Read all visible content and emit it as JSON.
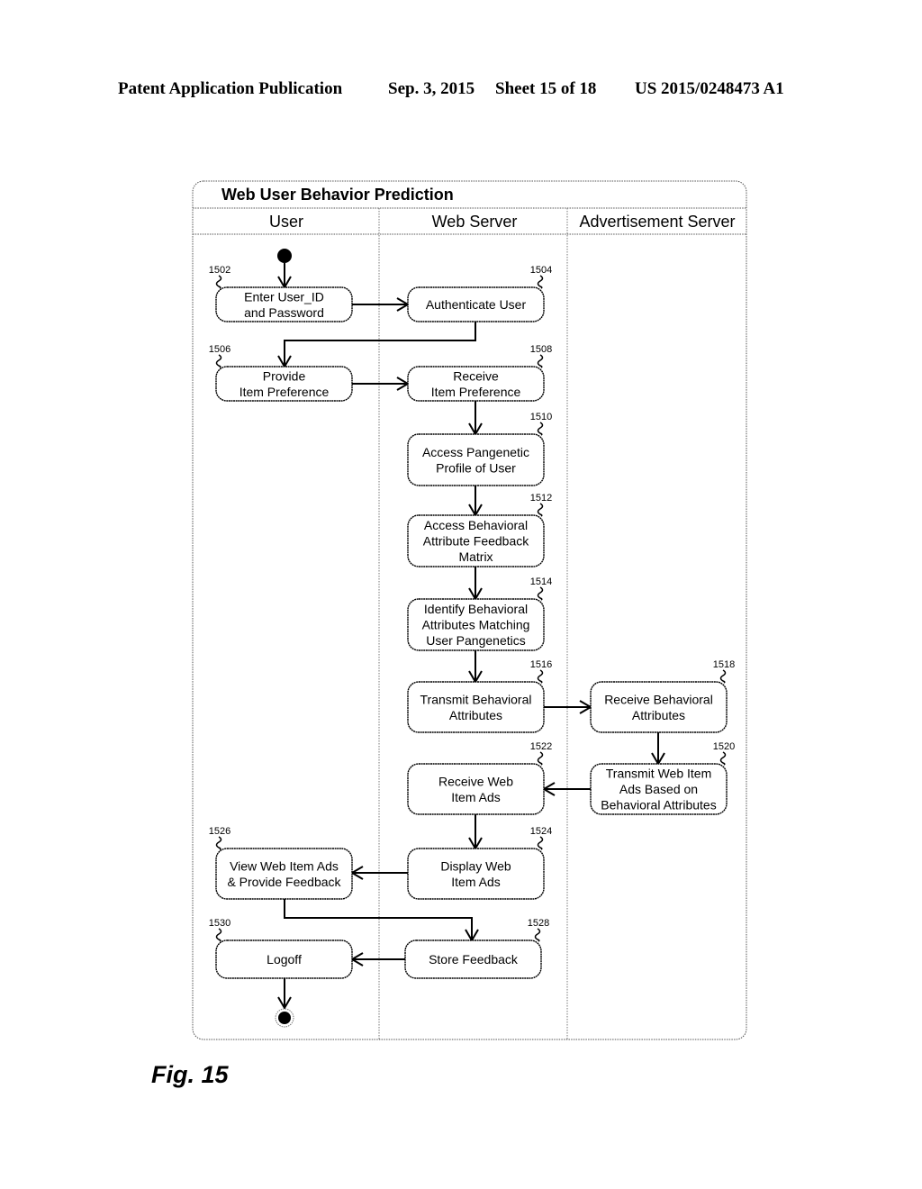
{
  "header": {
    "publication": "Patent Application Publication",
    "date": "Sep. 3, 2015",
    "sheet": "Sheet 15 of 18",
    "number": "US 2015/0248473 A1"
  },
  "diagram": {
    "title": "Web User Behavior Prediction",
    "lanes": [
      "User",
      "Web Server",
      "Advertisement Server"
    ],
    "nodes": [
      {
        "id": "1502",
        "ref": "1502",
        "lane": 0,
        "lines": [
          "Enter User_ID",
          "and Password"
        ]
      },
      {
        "id": "1504",
        "ref": "1504",
        "lane": 1,
        "lines": [
          "Authenticate User"
        ]
      },
      {
        "id": "1506",
        "ref": "1506",
        "lane": 0,
        "lines": [
          "Provide",
          "Item Preference"
        ]
      },
      {
        "id": "1508",
        "ref": "1508",
        "lane": 1,
        "lines": [
          "Receive",
          "Item Preference"
        ]
      },
      {
        "id": "1510",
        "ref": "1510",
        "lane": 1,
        "lines": [
          "Access Pangenetic",
          "Profile of User"
        ]
      },
      {
        "id": "1512",
        "ref": "1512",
        "lane": 1,
        "lines": [
          "Access Behavioral",
          "Attribute Feedback",
          "Matrix"
        ]
      },
      {
        "id": "1514",
        "ref": "1514",
        "lane": 1,
        "lines": [
          "Identify Behavioral",
          "Attributes Matching",
          "User Pangenetics"
        ]
      },
      {
        "id": "1516",
        "ref": "1516",
        "lane": 1,
        "lines": [
          "Transmit Behavioral",
          "Attributes"
        ]
      },
      {
        "id": "1518",
        "ref": "1518",
        "lane": 2,
        "lines": [
          "Receive Behavioral",
          "Attributes"
        ]
      },
      {
        "id": "1520",
        "ref": "1520",
        "lane": 2,
        "lines": [
          "Transmit Web Item",
          "Ads Based on",
          "Behavioral Attributes"
        ]
      },
      {
        "id": "1522",
        "ref": "1522",
        "lane": 1,
        "lines": [
          "Receive Web",
          "Item Ads"
        ]
      },
      {
        "id": "1524",
        "ref": "1524",
        "lane": 1,
        "lines": [
          "Display Web",
          "Item Ads"
        ]
      },
      {
        "id": "1526",
        "ref": "1526",
        "lane": 0,
        "lines": [
          "View Web Item Ads",
          "& Provide Feedback"
        ]
      },
      {
        "id": "1528",
        "ref": "1528",
        "lane": 1,
        "lines": [
          "Store Feedback"
        ]
      },
      {
        "id": "1530",
        "ref": "1530",
        "lane": 0,
        "lines": [
          "Logoff"
        ]
      }
    ],
    "edges": [
      {
        "from": "start",
        "to": "1502"
      },
      {
        "from": "1502",
        "to": "1504"
      },
      {
        "from": "1504",
        "to": "1506"
      },
      {
        "from": "1506",
        "to": "1508"
      },
      {
        "from": "1508",
        "to": "1510"
      },
      {
        "from": "1510",
        "to": "1512"
      },
      {
        "from": "1512",
        "to": "1514"
      },
      {
        "from": "1514",
        "to": "1516"
      },
      {
        "from": "1516",
        "to": "1518"
      },
      {
        "from": "1518",
        "to": "1520"
      },
      {
        "from": "1520",
        "to": "1522"
      },
      {
        "from": "1522",
        "to": "1524"
      },
      {
        "from": "1524",
        "to": "1526"
      },
      {
        "from": "1526",
        "to": "1528"
      },
      {
        "from": "1528",
        "to": "1530"
      },
      {
        "from": "1530",
        "to": "end"
      }
    ]
  },
  "figure_label": "Fig. 15"
}
